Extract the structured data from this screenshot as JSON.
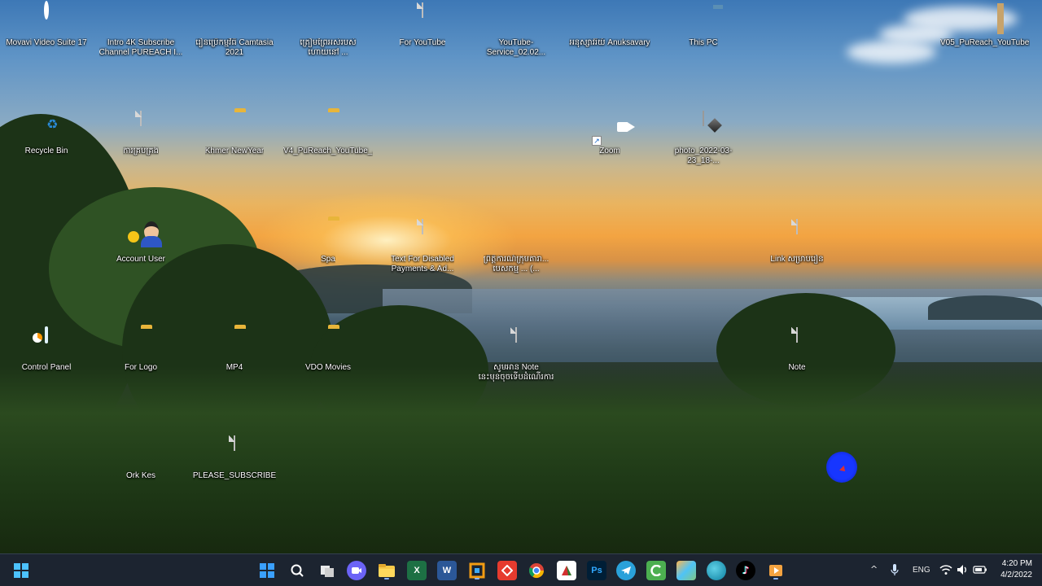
{
  "desktop": {
    "icons": [
      {
        "label": "Movavi Video Suite 17",
        "icon": "movavi-app-icon"
      },
      {
        "label": "Intro 4K Subscribe\nChannel PUREACH I...",
        "icon": "printer-file-icon"
      },
      {
        "label": "រៀនប្រើកម្មវិធី Camtasia\n2021",
        "icon": "camtasia-icon"
      },
      {
        "label": "ត្រៀមព្រៃអស់របស់\nហោយនៅ ...",
        "icon": "video-file-icon"
      },
      {
        "label": "For YouTube",
        "icon": "text-file-icon"
      },
      {
        "label": "YouTube-Service_02.02...",
        "icon": "video-file-icon"
      },
      {
        "label": "អនុស្សាវរីយ៍ Anuksavary",
        "icon": "video-file-icon"
      },
      {
        "label": "This PC",
        "icon": "monitor-icon"
      },
      {
        "label": "V05_PuReach_YouTube...",
        "icon": "winrar-archive-icon"
      },
      {
        "label": "Recycle Bin",
        "icon": "recycle-bin-icon"
      },
      {
        "label": "ការគ្រប់គ្រង",
        "icon": "text-file-icon"
      },
      {
        "label": "Khmer NewYear",
        "icon": "folder-icon"
      },
      {
        "label": "V4_PuReach_YouTube_...",
        "icon": "folder-icon"
      },
      {
        "label": "Zoom",
        "icon": "zoom-app-icon"
      },
      {
        "label": "photo_2022-03-23_18-...",
        "icon": "image-file-icon"
      },
      {
        "label": "Account User",
        "icon": "account-user-icon"
      },
      {
        "label": "Spa",
        "icon": "folder-icon"
      },
      {
        "label": "Text For Disabled\nPayments & Ad...",
        "icon": "text-file-icon"
      },
      {
        "label": "ព្រឹត្តិការណ៍ក្រុមតារា...\nបេសកម្ម ... (...",
        "icon": "video-file-icon"
      },
      {
        "label": "Link សម្រាប់រៀន",
        "icon": "text-file-icon"
      },
      {
        "label": "Control Panel",
        "icon": "control-panel-icon"
      },
      {
        "label": "For Logo",
        "icon": "folder-icon"
      },
      {
        "label": "MP4",
        "icon": "folder-icon"
      },
      {
        "label": "VDO Movies",
        "icon": "folder-icon"
      },
      {
        "label": "សូមអាន Note\nនេះមុនចុចទើបដំណើរការ",
        "icon": "text-file-icon"
      },
      {
        "label": "Note",
        "icon": "text-file-icon"
      },
      {
        "label": "Ork Kes",
        "icon": "folder-blue-icon"
      },
      {
        "label": "PLEASE_SUBSCRIBE",
        "icon": "text-file-icon"
      }
    ]
  },
  "taskbar": {
    "apps": [
      {
        "name": "start-button",
        "label": ""
      },
      {
        "name": "search-button",
        "label": ""
      },
      {
        "name": "task-view-button",
        "label": ""
      },
      {
        "name": "chat-button",
        "label": ""
      },
      {
        "name": "file-explorer-button",
        "label": ""
      },
      {
        "name": "excel-button",
        "label": "X"
      },
      {
        "name": "word-button",
        "label": "W"
      },
      {
        "name": "app-orange-button",
        "label": ""
      },
      {
        "name": "anydesk-button",
        "label": ""
      },
      {
        "name": "chrome-button",
        "label": ""
      },
      {
        "name": "app-red-green-button",
        "label": ""
      },
      {
        "name": "photoshop-button",
        "label": "Ps"
      },
      {
        "name": "telegram-button",
        "label": ""
      },
      {
        "name": "camtasia-button",
        "label": ""
      },
      {
        "name": "app-colorful-button",
        "label": ""
      },
      {
        "name": "edge-button",
        "label": ""
      },
      {
        "name": "tiktok-button",
        "label": ""
      },
      {
        "name": "media-player-button",
        "label": ""
      }
    ],
    "tray": {
      "language": "ENG",
      "time": "4:20 PM",
      "date": "4/2/2022"
    }
  },
  "colors": {
    "taskbar_bg": "#1c2430",
    "accent": "#3b82f6"
  }
}
